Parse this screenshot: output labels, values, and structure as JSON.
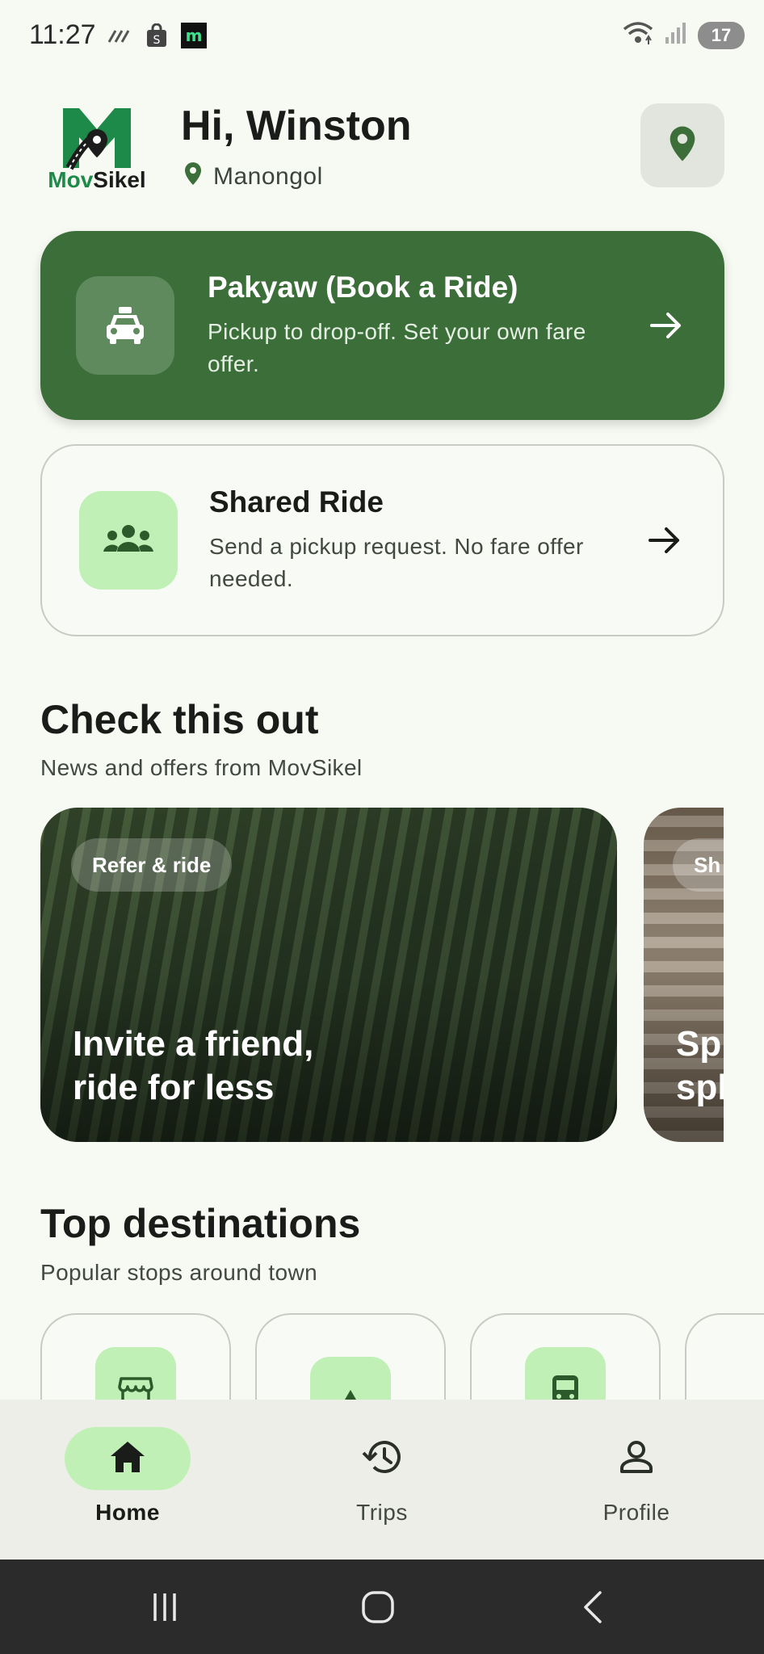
{
  "status_bar": {
    "time": "11:27",
    "battery": "17",
    "icons": [
      "signal-stripes-icon",
      "shopping-bag-icon",
      "m-app-icon",
      "wifi-icon",
      "cell-signal-icon",
      "battery-icon"
    ]
  },
  "header": {
    "logo_text": "MovSikel",
    "greeting": "Hi, Winston",
    "location": "Manongol",
    "location_icon": "map-pin-icon"
  },
  "actions": {
    "book_ride": {
      "title": "Pakyaw (Book a Ride)",
      "description": "Pickup to drop-off. Set your own fare offer.",
      "icon": "taxi-icon"
    },
    "shared_ride": {
      "title": "Shared Ride",
      "description": "Send a pickup request. No fare offer needed.",
      "icon": "group-icon"
    }
  },
  "check_out": {
    "title": "Check this out",
    "subtitle": "News and offers from MovSikel",
    "promos": [
      {
        "chip": "Refer & ride",
        "title": "Invite a friend,\nride for less"
      },
      {
        "chip": "Sh",
        "title": "Sp\nspl"
      }
    ]
  },
  "destinations": {
    "title": "Top destinations",
    "subtitle": "Popular stops around town",
    "items": [
      {
        "icon": "store-icon"
      },
      {
        "icon": "tree-icon"
      },
      {
        "icon": "bus-icon"
      },
      {
        "icon": ""
      }
    ]
  },
  "bottom_nav": {
    "items": [
      {
        "label": "Home",
        "icon": "home-icon",
        "active": true
      },
      {
        "label": "Trips",
        "icon": "history-icon",
        "active": false
      },
      {
        "label": "Profile",
        "icon": "person-icon",
        "active": false
      }
    ]
  },
  "colors": {
    "background": "#f6faf2",
    "primary": "#3c6e3a",
    "accent_light": "#c0f0b5",
    "logo_green": "#1e8a4a"
  }
}
